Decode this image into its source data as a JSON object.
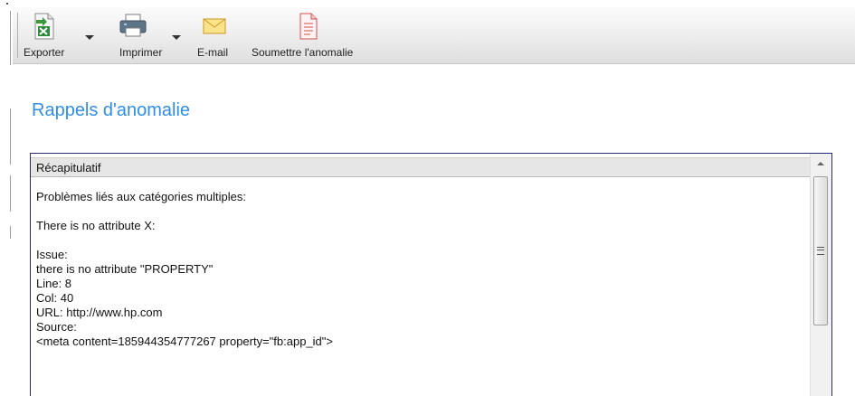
{
  "toolbar": {
    "export_label": "Exporter",
    "print_label": "Imprimer",
    "email_label": "E-mail",
    "submit_label": "Soumettre l'anomalie"
  },
  "page": {
    "title": "Rappels d'anomalie"
  },
  "summary": {
    "header": "Récapitulatif",
    "lines": [
      "Problèmes liés aux catégories multiples:",
      "",
      "There is no attribute X:",
      "",
      "Issue:",
      "there is no attribute \"PROPERTY\"",
      "Line: 8",
      "Col: 40",
      "URL: http://www.hp.com",
      "Source:",
      "<meta content=185944354777267 property=\"fb:app_id\">"
    ]
  },
  "icons": {
    "export": "export-excel-icon",
    "print": "printer-icon",
    "email": "envelope-icon",
    "submit": "document-report-icon"
  },
  "colors": {
    "title": "#2f8fe6",
    "panel_border": "#2a2a78"
  }
}
